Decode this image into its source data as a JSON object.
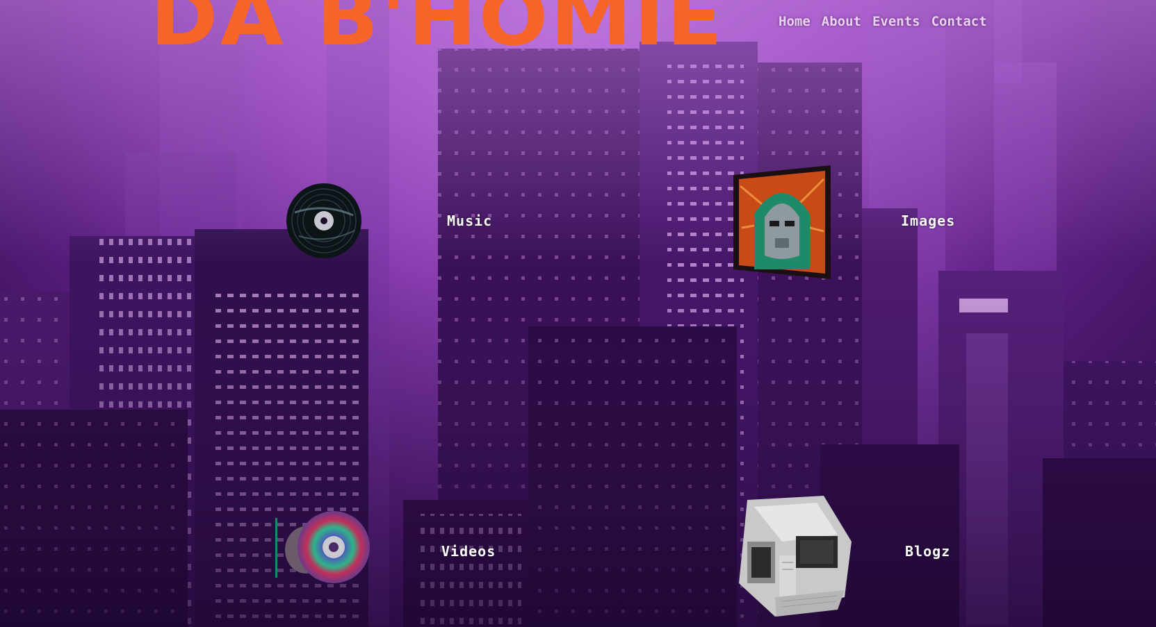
{
  "site": {
    "title": "DA B'HOMIE"
  },
  "nav": {
    "items": [
      {
        "label": "Home"
      },
      {
        "label": "About"
      },
      {
        "label": "Events"
      },
      {
        "label": "Contact"
      }
    ]
  },
  "tiles": {
    "music": {
      "label": "Music",
      "icon": "vinyl-record-icon"
    },
    "images": {
      "label": "Images",
      "icon": "masked-villain-artwork-icon"
    },
    "videos": {
      "label": "Videos",
      "icon": "cd-disc-icon"
    },
    "blogz": {
      "label": "Blogz",
      "icon": "computer-cube-icon"
    }
  },
  "colors": {
    "title": "#f7642a",
    "nav_text": "#e9d3f2",
    "label_text": "#ffffff",
    "sky_top": "#b56ad9",
    "sky_bottom": "#2c0b45"
  }
}
